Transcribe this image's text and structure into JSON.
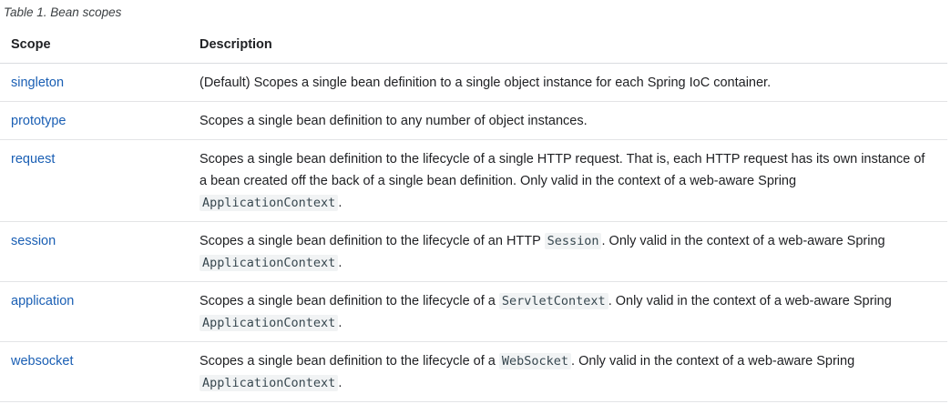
{
  "caption": "Table 1. Bean scopes",
  "headers": {
    "scope": "Scope",
    "description": "Description"
  },
  "rows": [
    {
      "scope": "singleton",
      "parts": [
        {
          "t": "(Default) Scopes a single bean definition to a single object instance for each Spring IoC container."
        }
      ]
    },
    {
      "scope": "prototype",
      "parts": [
        {
          "t": "Scopes a single bean definition to any number of object instances."
        }
      ]
    },
    {
      "scope": "request",
      "parts": [
        {
          "t": "Scopes a single bean definition to the lifecycle of a single HTTP request. That is, each HTTP request has its own instance of a bean created off the back of a single bean definition. Only valid in the context of a web-aware Spring "
        },
        {
          "code": "ApplicationContext"
        },
        {
          "t": "."
        }
      ]
    },
    {
      "scope": "session",
      "parts": [
        {
          "t": "Scopes a single bean definition to the lifecycle of an HTTP "
        },
        {
          "code": "Session"
        },
        {
          "t": ". Only valid in the context of a web-aware Spring "
        },
        {
          "code": "ApplicationContext"
        },
        {
          "t": "."
        }
      ]
    },
    {
      "scope": "application",
      "parts": [
        {
          "t": "Scopes a single bean definition to the lifecycle of a "
        },
        {
          "code": "ServletContext"
        },
        {
          "t": ". Only valid in the context of a web-aware Spring "
        },
        {
          "code": "ApplicationContext"
        },
        {
          "t": "."
        }
      ]
    },
    {
      "scope": "websocket",
      "parts": [
        {
          "t": "Scopes a single bean definition to the lifecycle of a "
        },
        {
          "code": "WebSocket"
        },
        {
          "t": ". Only valid in the context of a web-aware Spring "
        },
        {
          "code": "ApplicationContext"
        },
        {
          "t": "."
        }
      ]
    }
  ]
}
